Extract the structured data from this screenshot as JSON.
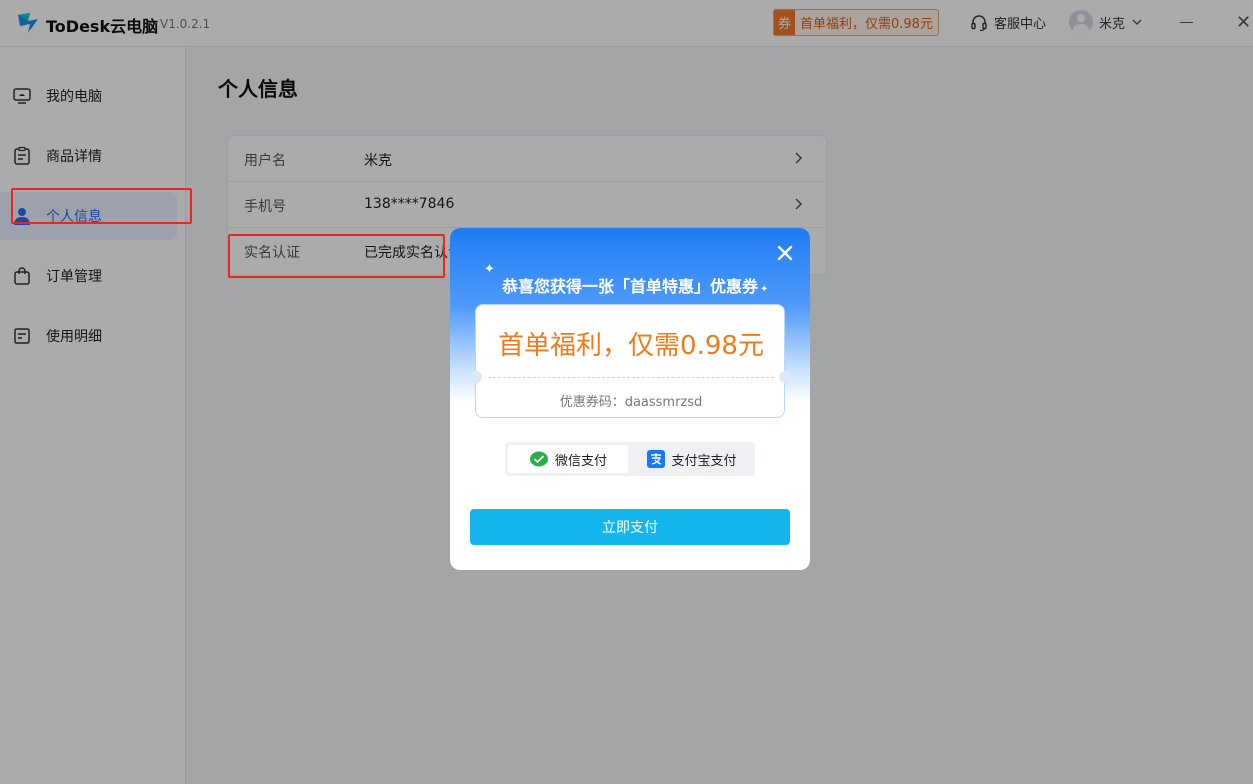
{
  "app": {
    "title": "ToDesk云电脑",
    "version": "V1.0.2.1"
  },
  "header": {
    "promo_tag": "券",
    "promo_text": "首单福利，仅需0.98元",
    "support": "客服中心",
    "username": "米克"
  },
  "sidebar": {
    "items": [
      {
        "label": "我的电脑"
      },
      {
        "label": "商品详情"
      },
      {
        "label": "个人信息"
      },
      {
        "label": "订单管理"
      },
      {
        "label": "使用明细"
      }
    ]
  },
  "page": {
    "title": "个人信息"
  },
  "info": {
    "rows": [
      {
        "label": "用户名",
        "value": "米克"
      },
      {
        "label": "手机号",
        "value": "138****7846"
      },
      {
        "label": "实名认证",
        "value": "已完成实名认证"
      }
    ]
  },
  "modal": {
    "heading": "恭喜您获得一张「首单特惠」优惠券",
    "coupon_title": "首单福利，仅需0.98元",
    "coupon_code": "优惠券码：daassmrzsd",
    "pay_wechat": "微信支付",
    "pay_alipay": "支付宝支付",
    "pay_button": "立即支付"
  },
  "colors": {
    "accent": "#2b6bf3",
    "promo": "#f07b2f",
    "pay_button": "#14b6ee",
    "highlight": "#e8281e"
  }
}
